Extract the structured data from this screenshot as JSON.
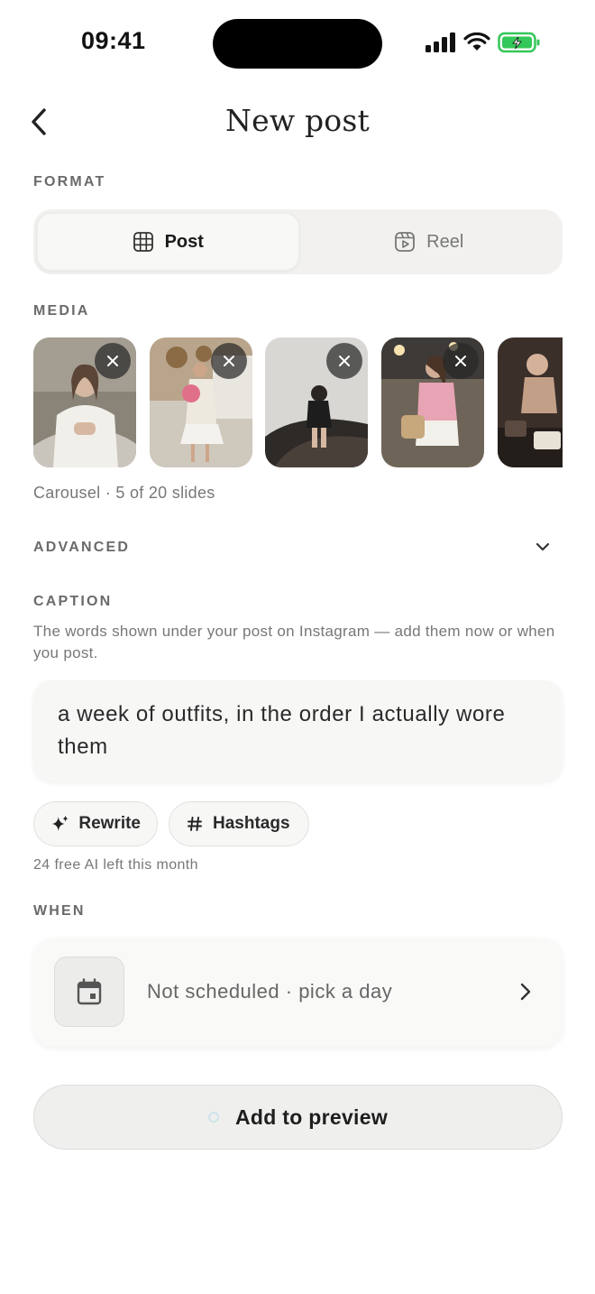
{
  "status_bar": {
    "time": "09:41"
  },
  "header": {
    "title": "New post"
  },
  "format": {
    "label": "FORMAT",
    "options": [
      {
        "label": "Post",
        "icon": "grid-icon",
        "selected": true
      },
      {
        "label": "Reel",
        "icon": "reel-icon",
        "selected": false
      }
    ]
  },
  "media": {
    "label": "MEDIA",
    "count_text": "Carousel · 5 of 20 slides"
  },
  "advanced": {
    "label": "ADVANCED"
  },
  "caption": {
    "label": "CAPTION",
    "help": "The words shown under your post on Instagram — add them now or when you post.",
    "text": "a week of outfits, in the order I actually wore them",
    "rewrite_label": "Rewrite",
    "hashtags_label": "Hashtags",
    "ai_quota": "24 free AI left this month"
  },
  "when": {
    "label": "WHEN",
    "value": "Not scheduled · pick a day"
  },
  "cta": {
    "label": "Add to preview"
  },
  "colors": {
    "background": "#ffffff",
    "surface": "#f2f1ef",
    "battery": "#34c759"
  }
}
